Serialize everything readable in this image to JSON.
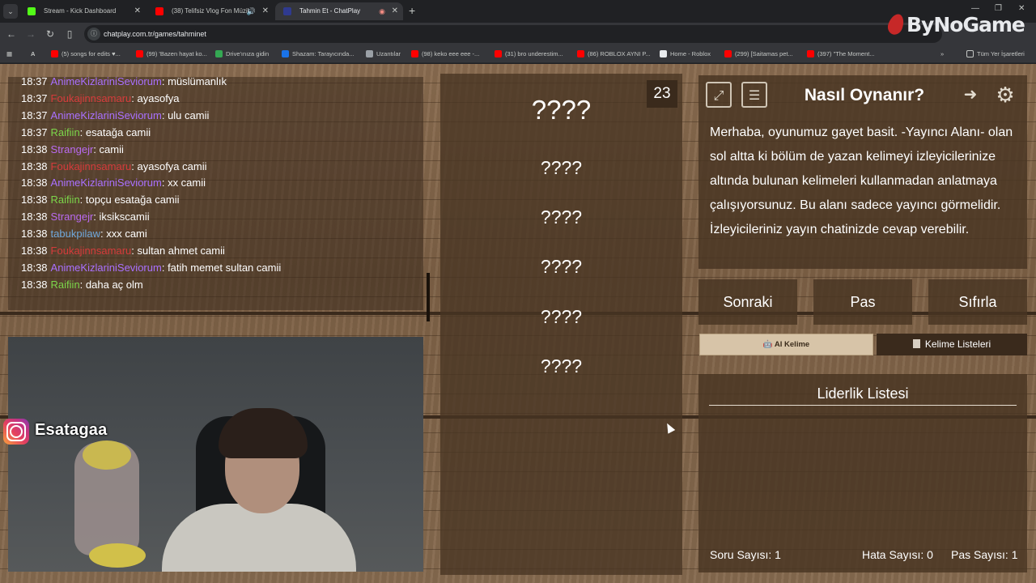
{
  "browser": {
    "tabs": [
      {
        "title": "Stream - Kick Dashboard",
        "fav_color": "#53fc18",
        "active": false
      },
      {
        "title": "(38) Telifsiz Vlog Fon Müzik",
        "fav_color": "#ff0000",
        "active": false
      },
      {
        "title": "Tahmin Et - ChatPlay",
        "fav_color": "#2f3a8f",
        "active": true
      }
    ],
    "url": "chatplay.com.tr/games/tahminet",
    "bookmarks": [
      {
        "label": "(5) songs for edits ♥...",
        "color": "#ff0000"
      },
      {
        "label": "(99) 'Bazen hayat ko...",
        "color": "#ff0000"
      },
      {
        "label": "Drive'ınıza gidin",
        "color": "#34a853"
      },
      {
        "label": "Shazam: Tarayıcında...",
        "color": "#1a73e8"
      },
      {
        "label": "Uzantılar",
        "color": "#9aa0a6"
      },
      {
        "label": "(98) keko eee eee -...",
        "color": "#ff0000"
      },
      {
        "label": "(31) bro underestim...",
        "color": "#ff0000"
      },
      {
        "label": "(86) ROBLOX AYNI P...",
        "color": "#ff0000"
      },
      {
        "label": "Home - Roblox",
        "color": "#e8eaed"
      },
      {
        "label": "(299) [Saitamas pet...",
        "color": "#ff0000"
      },
      {
        "label": "(397) \"The Moment...",
        "color": "#ff0000"
      }
    ],
    "all_bookmarks": "Tüm Yer İşaretleri",
    "watermark": "ByNoGame"
  },
  "chat": [
    {
      "time": "18:37",
      "user": "AnimeKizlariniSeviorum",
      "color": "#a970ff",
      "message": "müslümanlık"
    },
    {
      "time": "18:37",
      "user": "Foukajinnsamaru",
      "color": "#d63b3b",
      "message": "ayasofya"
    },
    {
      "time": "18:37",
      "user": "AnimeKizlariniSeviorum",
      "color": "#a970ff",
      "message": "ulu camii"
    },
    {
      "time": "18:37",
      "user": "Raifiin",
      "color": "#7cd64a",
      "message": "esatağa camii"
    },
    {
      "time": "18:38",
      "user": "Strangejr",
      "color": "#b96af0",
      "message": "camii"
    },
    {
      "time": "18:38",
      "user": "Foukajinnsamaru",
      "color": "#d63b3b",
      "message": "ayasofya camii"
    },
    {
      "time": "18:38",
      "user": "AnimeKizlariniSeviorum",
      "color": "#a970ff",
      "message": "xx camii"
    },
    {
      "time": "18:38",
      "user": "Raifiin",
      "color": "#7cd64a",
      "message": "topçu esatağa camii"
    },
    {
      "time": "18:38",
      "user": "Strangejr",
      "color": "#b96af0",
      "message": "iksikscamii"
    },
    {
      "time": "18:38",
      "user": "tabukpilaw",
      "color": "#6fa8dc",
      "message": "xxx cami"
    },
    {
      "time": "18:38",
      "user": "Foukajinnsamaru",
      "color": "#d63b3b",
      "message": "sultan ahmet camii"
    },
    {
      "time": "18:38",
      "user": "AnimeKizlariniSeviorum",
      "color": "#a970ff",
      "message": "fatih memet sultan camii"
    },
    {
      "time": "18:38",
      "user": "Raifiin",
      "color": "#7cd64a",
      "message": "daha aç olm"
    }
  ],
  "stream": {
    "instagram_name": "Esatagaa"
  },
  "game": {
    "counter": "23",
    "main_word": "????",
    "forbidden_words": [
      "????",
      "????",
      "????",
      "????",
      "????"
    ]
  },
  "how_to": {
    "title": "Nasıl Oynanır?",
    "text": "Merhaba, oyunumuz gayet basit. -Yayıncı Alanı- olan sol altta ki bölüm de yazan kelimeyi izleyicilerinize altında bulunan kelimeleri kullanmadan anlatmaya çalışıyorsunuz. Bu alanı sadece yayıncı görmelidir. İzleyicileriniz yayın chatinizde cevap verebilir."
  },
  "controls": {
    "next": "Sonraki",
    "pass": "Pas",
    "reset": "Sıfırla"
  },
  "ai_word": "🤖 AI Kelime",
  "word_lists": "Kelime Listeleri",
  "leaderboard": {
    "title": "Liderlik Listesi",
    "question_count": "Soru Sayısı: 1",
    "error_count": "Hata Sayısı: 0",
    "pass_count": "Pas Sayısı: 1"
  }
}
